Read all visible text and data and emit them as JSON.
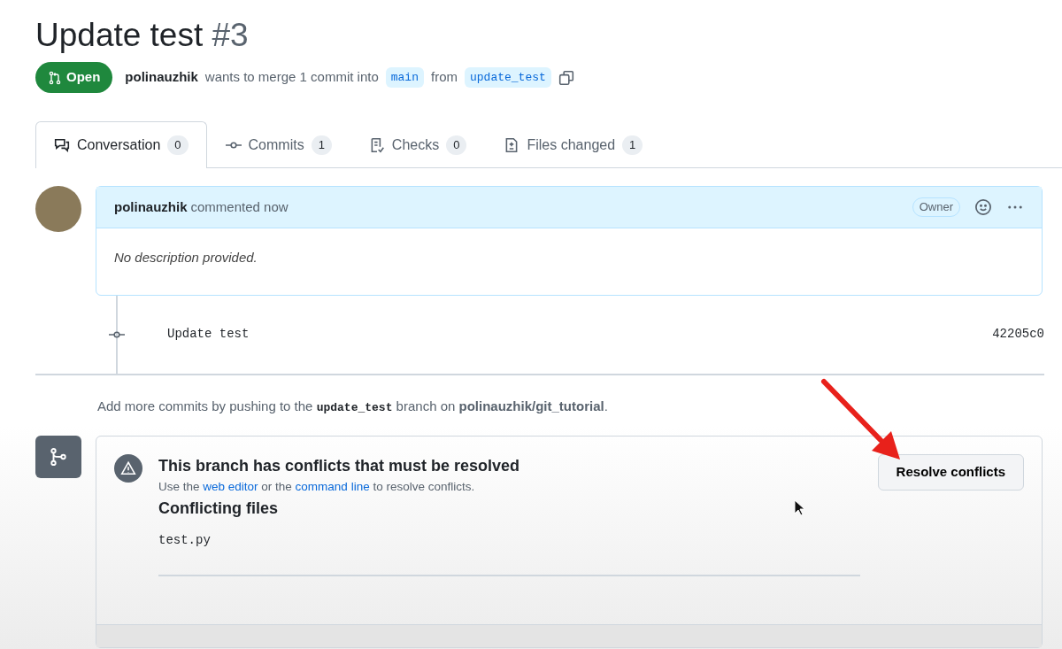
{
  "title": {
    "text": "Update test",
    "number": "#3"
  },
  "state": {
    "label": "Open",
    "kind": "open"
  },
  "summary": {
    "author": "polinauzhik",
    "text": "wants to merge 1 commit into",
    "base": "main",
    "from": "from",
    "head": "update_test"
  },
  "tabs": [
    {
      "label": "Conversation",
      "count": "0",
      "kind": "conversation",
      "selected": true
    },
    {
      "label": "Commits",
      "count": "1",
      "kind": "commit",
      "selected": false
    },
    {
      "label": "Checks",
      "count": "0",
      "kind": "checks",
      "selected": false
    },
    {
      "label": "Files changed",
      "count": "1",
      "kind": "files",
      "selected": false
    }
  ],
  "comment": {
    "author": "polinauzhik",
    "action": "commented now",
    "role": "Owner",
    "body": "No description provided."
  },
  "commits": [
    {
      "message": "Update test",
      "sha": "42205c0"
    }
  ],
  "push_hint": [
    {
      "kind": "text",
      "text": "Add more commits by pushing to the "
    },
    {
      "kind": "code",
      "text": "update_test"
    },
    {
      "kind": "text",
      "text": " branch on "
    },
    {
      "kind": "bold",
      "text": "polinauzhik/git_tutorial"
    },
    {
      "kind": "text",
      "text": "."
    }
  ],
  "merge_box": {
    "title": "This branch has conflicts that must be resolved",
    "hint": [
      {
        "kind": "text",
        "text": "Use the "
      },
      {
        "kind": "link",
        "text": "web editor"
      },
      {
        "kind": "text",
        "text": " or the "
      },
      {
        "kind": "link",
        "text": "command line"
      },
      {
        "kind": "text",
        "text": " to resolve conflicts."
      }
    ],
    "button": "Resolve conflicts",
    "files_heading": "Conflicting files",
    "files": [
      "test.py"
    ]
  }
}
